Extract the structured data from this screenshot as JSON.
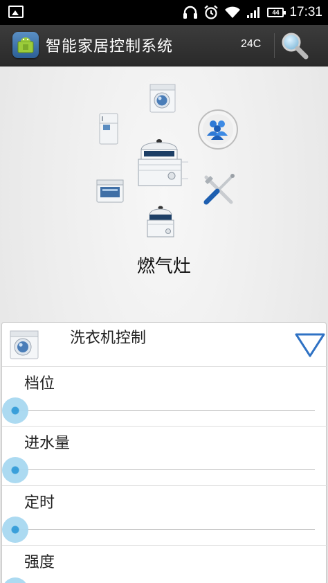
{
  "status_bar": {
    "time": "17:31",
    "battery": "44",
    "icons": [
      "image-icon",
      "headset-icon",
      "alarm-icon",
      "wifi-icon",
      "signal-icon",
      "battery-icon"
    ]
  },
  "action_bar": {
    "app_title": "智能家居控制系统",
    "temperature": "24C",
    "icons": [
      "android-app-icon",
      "search-icon"
    ]
  },
  "appliance_menu": {
    "selected_device": "燃气灶",
    "items": [
      "washing-machine-icon",
      "refrigerator-icon",
      "contacts-icon",
      "gas-stove-icon",
      "oven-icon",
      "tools-icon",
      "cooker-icon"
    ]
  },
  "control_panel": {
    "title": "洗衣机控制",
    "rows": [
      {
        "label": "档位",
        "value": 0
      },
      {
        "label": "进水量",
        "value": 0
      },
      {
        "label": "定时",
        "value": 0
      },
      {
        "label": "强度",
        "value": 0
      }
    ]
  },
  "colors": {
    "accent_blue": "#2f9ad8",
    "action_bar": "#333333",
    "background": "#ececec"
  }
}
